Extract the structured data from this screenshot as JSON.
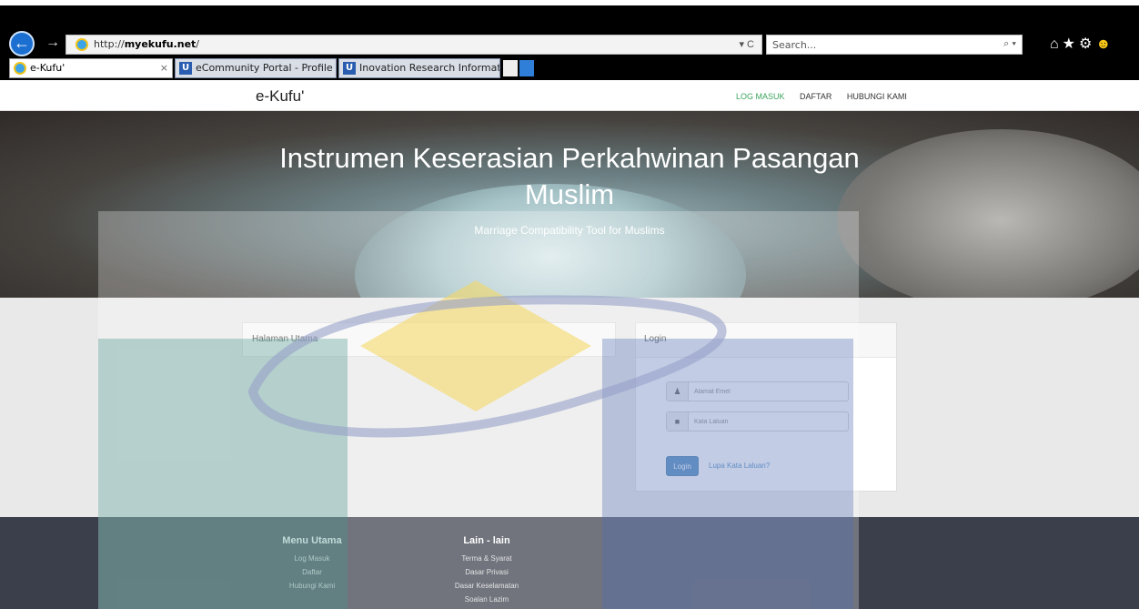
{
  "browser": {
    "url_prefix": "http://",
    "url_domain": "myekufu.net",
    "url_path": "/",
    "address_controls": "▾ C",
    "search_placeholder": "Search...",
    "search_controls": "⌕ ▾",
    "tabs": [
      {
        "label": "e-Kufu'",
        "close": "×"
      },
      {
        "label": "eCommunity Portal - Profile In..."
      },
      {
        "label": "Inovation Research Informatio..."
      }
    ],
    "tab_icon_letter": "U"
  },
  "site": {
    "brand": "e-Kufu'",
    "nav": [
      "LOG MASUK",
      "DAFTAR",
      "HUBUNGI KAMI"
    ],
    "hero_title": "Instrumen Keserasian Perkahwinan Pasangan Muslim",
    "hero_subtitle": "Marriage Compatibility Tool for Muslims",
    "main_panel_title": "Halaman Utama",
    "login_panel_title": "Login",
    "email_placeholder": "Alamat Emel",
    "password_placeholder": "Kata Laluan",
    "login_button": "Login",
    "forgot_link": "Lupa Kata Laluan?"
  },
  "footer": {
    "col1": {
      "title": "Menu Utama",
      "items": [
        "Log Masuk",
        "Daftar",
        "Hubungi Kami"
      ]
    },
    "col2": {
      "title": "Lain - lain",
      "items": [
        "Terma & Syarat",
        "Dasar Privasi",
        "Dasar Keselamatan",
        "Soalan Lazim"
      ]
    }
  },
  "colors": {
    "nav_active": "#3aa55c",
    "link": "#337ab7",
    "footer_bg": "#3b3f4b"
  }
}
